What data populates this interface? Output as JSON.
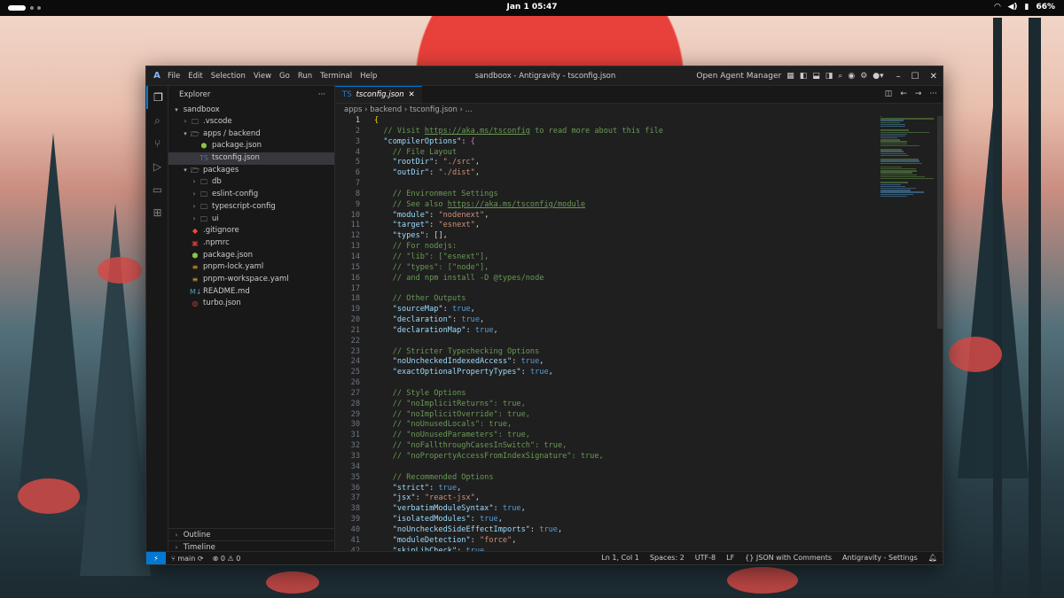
{
  "desktop": {
    "clock": "Jan 1  05:47",
    "battery": "66%",
    "wifi_icon": "wifi-icon",
    "volume_icon": "volume-icon",
    "battery_icon": "battery-icon"
  },
  "window": {
    "title": "sandboox - Antigravity - tsconfig.json",
    "menu": [
      "File",
      "Edit",
      "Selection",
      "View",
      "Go",
      "Run",
      "Terminal",
      "Help"
    ],
    "agent_manager": "Open Agent Manager"
  },
  "sidebar": {
    "header": "Explorer",
    "root": "sandboox",
    "tree": [
      {
        "label": ".vscode",
        "depth": 1,
        "kind": "folder",
        "open": false
      },
      {
        "label": "apps / backend",
        "depth": 1,
        "kind": "folder",
        "open": true
      },
      {
        "label": "package.json",
        "depth": 2,
        "kind": "npm"
      },
      {
        "label": "tsconfig.json",
        "depth": 2,
        "kind": "ts",
        "selected": true
      },
      {
        "label": "packages",
        "depth": 1,
        "kind": "folder",
        "open": true
      },
      {
        "label": "db",
        "depth": 2,
        "kind": "folder",
        "open": false
      },
      {
        "label": "eslint-config",
        "depth": 2,
        "kind": "folder",
        "open": false
      },
      {
        "label": "typescript-config",
        "depth": 2,
        "kind": "folder",
        "open": false
      },
      {
        "label": "ui",
        "depth": 2,
        "kind": "folder",
        "open": false
      },
      {
        "label": ".gitignore",
        "depth": 1,
        "kind": "git"
      },
      {
        "label": ".npmrc",
        "depth": 1,
        "kind": "npmrc"
      },
      {
        "label": "package.json",
        "depth": 1,
        "kind": "npm"
      },
      {
        "label": "pnpm-lock.yaml",
        "depth": 1,
        "kind": "yaml"
      },
      {
        "label": "pnpm-workspace.yaml",
        "depth": 1,
        "kind": "yaml"
      },
      {
        "label": "README.md",
        "depth": 1,
        "kind": "md"
      },
      {
        "label": "turbo.json",
        "depth": 1,
        "kind": "turbo"
      }
    ],
    "sections": [
      "Outline",
      "Timeline"
    ]
  },
  "editor": {
    "tab_label": "tsconfig.json",
    "breadcrumb": [
      "apps",
      "backend",
      "tsconfig.json",
      "..."
    ],
    "lines": [
      [
        [
          "brace",
          "{"
        ]
      ],
      [
        [
          "cmt",
          "  // Visit "
        ],
        [
          "url",
          "https://aka.ms/tsconfig"
        ],
        [
          "cmt",
          " to read more about this file"
        ]
      ],
      [
        [
          "key",
          "  \"compilerOptions\""
        ],
        [
          "pun",
          ": "
        ],
        [
          "brace2",
          "{"
        ]
      ],
      [
        [
          "cmt",
          "    // File Layout"
        ]
      ],
      [
        [
          "key",
          "    \"rootDir\""
        ],
        [
          "pun",
          ": "
        ],
        [
          "str",
          "\"./src\""
        ],
        [
          "pun",
          ","
        ]
      ],
      [
        [
          "key",
          "    \"outDir\""
        ],
        [
          "pun",
          ": "
        ],
        [
          "str",
          "\"./dist\""
        ],
        [
          "pun",
          ","
        ]
      ],
      [],
      [
        [
          "cmt",
          "    // Environment Settings"
        ]
      ],
      [
        [
          "cmt",
          "    // See also "
        ],
        [
          "url",
          "https://aka.ms/tsconfig/module"
        ]
      ],
      [
        [
          "key",
          "    \"module\""
        ],
        [
          "pun",
          ": "
        ],
        [
          "str",
          "\"nodenext\""
        ],
        [
          "pun",
          ","
        ]
      ],
      [
        [
          "key",
          "    \"target\""
        ],
        [
          "pun",
          ": "
        ],
        [
          "str",
          "\"esnext\""
        ],
        [
          "pun",
          ","
        ]
      ],
      [
        [
          "key",
          "    \"types\""
        ],
        [
          "pun",
          ": [],"
        ]
      ],
      [
        [
          "cmt",
          "    // For nodejs:"
        ]
      ],
      [
        [
          "cmt",
          "    // \"lib\": [\"esnext\"],"
        ]
      ],
      [
        [
          "cmt",
          "    // \"types\": [\"node\"],"
        ]
      ],
      [
        [
          "cmt",
          "    // and npm install -D @types/node"
        ]
      ],
      [],
      [
        [
          "cmt",
          "    // Other Outputs"
        ]
      ],
      [
        [
          "key",
          "    \"sourceMap\""
        ],
        [
          "pun",
          ": "
        ],
        [
          "kw",
          "true"
        ],
        [
          "pun",
          ","
        ]
      ],
      [
        [
          "key",
          "    \"declaration\""
        ],
        [
          "pun",
          ": "
        ],
        [
          "kw",
          "true"
        ],
        [
          "pun",
          ","
        ]
      ],
      [
        [
          "key",
          "    \"declarationMap\""
        ],
        [
          "pun",
          ": "
        ],
        [
          "kw",
          "true"
        ],
        [
          "pun",
          ","
        ]
      ],
      [],
      [
        [
          "cmt",
          "    // Stricter Typechecking Options"
        ]
      ],
      [
        [
          "key",
          "    \"noUncheckedIndexedAccess\""
        ],
        [
          "pun",
          ": "
        ],
        [
          "kw",
          "true"
        ],
        [
          "pun",
          ","
        ]
      ],
      [
        [
          "key",
          "    \"exactOptionalPropertyTypes\""
        ],
        [
          "pun",
          ": "
        ],
        [
          "kw",
          "true"
        ],
        [
          "pun",
          ","
        ]
      ],
      [],
      [
        [
          "cmt",
          "    // Style Options"
        ]
      ],
      [
        [
          "cmt",
          "    // \"noImplicitReturns\": true,"
        ]
      ],
      [
        [
          "cmt",
          "    // \"noImplicitOverride\": true,"
        ]
      ],
      [
        [
          "cmt",
          "    // \"noUnusedLocals\": true,"
        ]
      ],
      [
        [
          "cmt",
          "    // \"noUnusedParameters\": true,"
        ]
      ],
      [
        [
          "cmt",
          "    // \"noFallthroughCasesInSwitch\": true,"
        ]
      ],
      [
        [
          "cmt",
          "    // \"noPropertyAccessFromIndexSignature\": true,"
        ]
      ],
      [],
      [
        [
          "cmt",
          "    // Recommended Options"
        ]
      ],
      [
        [
          "key",
          "    \"strict\""
        ],
        [
          "pun",
          ": "
        ],
        [
          "kw",
          "true"
        ],
        [
          "pun",
          ","
        ]
      ],
      [
        [
          "key",
          "    \"jsx\""
        ],
        [
          "pun",
          ": "
        ],
        [
          "str",
          "\"react-jsx\""
        ],
        [
          "pun",
          ","
        ]
      ],
      [
        [
          "key",
          "    \"verbatimModuleSyntax\""
        ],
        [
          "pun",
          ": "
        ],
        [
          "kw",
          "true"
        ],
        [
          "pun",
          ","
        ]
      ],
      [
        [
          "key",
          "    \"isolatedModules\""
        ],
        [
          "pun",
          ": "
        ],
        [
          "kw",
          "true"
        ],
        [
          "pun",
          ","
        ]
      ],
      [
        [
          "key",
          "    \"noUncheckedSideEffectImports\""
        ],
        [
          "pun",
          ": "
        ],
        [
          "kw",
          "true"
        ],
        [
          "pun",
          ","
        ]
      ],
      [
        [
          "key",
          "    \"moduleDetection\""
        ],
        [
          "pun",
          ": "
        ],
        [
          "str",
          "\"force\""
        ],
        [
          "pun",
          ","
        ]
      ],
      [
        [
          "key",
          "    \"skipLibCheck\""
        ],
        [
          "pun",
          ": "
        ],
        [
          "kw",
          "true"
        ],
        [
          "pun",
          ","
        ]
      ]
    ]
  },
  "statusbar": {
    "branch": "main",
    "problems": "0",
    "warnings": "0",
    "position": "Ln 1, Col 1",
    "spaces": "Spaces: 2",
    "encoding": "UTF-8",
    "eol": "LF",
    "language": "{} JSON with Comments",
    "settings": "Antigravity - Settings"
  }
}
